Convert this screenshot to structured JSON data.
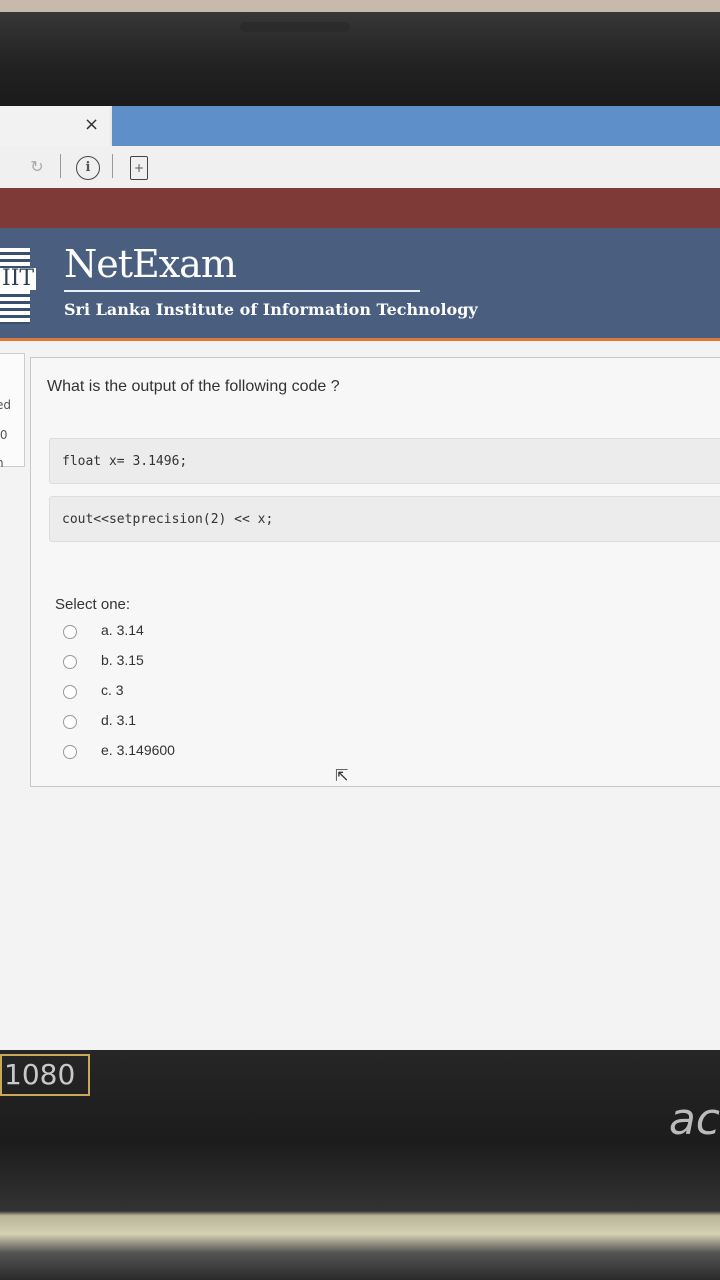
{
  "browser": {
    "close_glyph": "×",
    "reload_icon": "reload-icon",
    "info_icon": "info-icon",
    "page_icon": "page-icon"
  },
  "header": {
    "title": "NetExam",
    "subtitle": "Sri Lanka Institute of Information Technology",
    "logo_text": "IIT"
  },
  "side_panel": {
    "fragments": [
      "ed",
      ".0",
      "n"
    ]
  },
  "question": {
    "text": "What is the output of the following code ?",
    "code_lines": [
      "float x= 3.1496;",
      "cout<<setprecision(2) << x;"
    ],
    "select_label": "Select one:",
    "options": [
      "a. 3.14",
      "b. 3.15",
      "c. 3",
      "d. 3.1",
      "e. 3.149600"
    ]
  },
  "bezel": {
    "badge": "1080",
    "brand": "ac"
  },
  "colors": {
    "tab_blue": "#5e8fc8",
    "header_blue": "#4a5f80",
    "maroon_band": "#7e3a36",
    "accent_orange": "#e0773a"
  }
}
